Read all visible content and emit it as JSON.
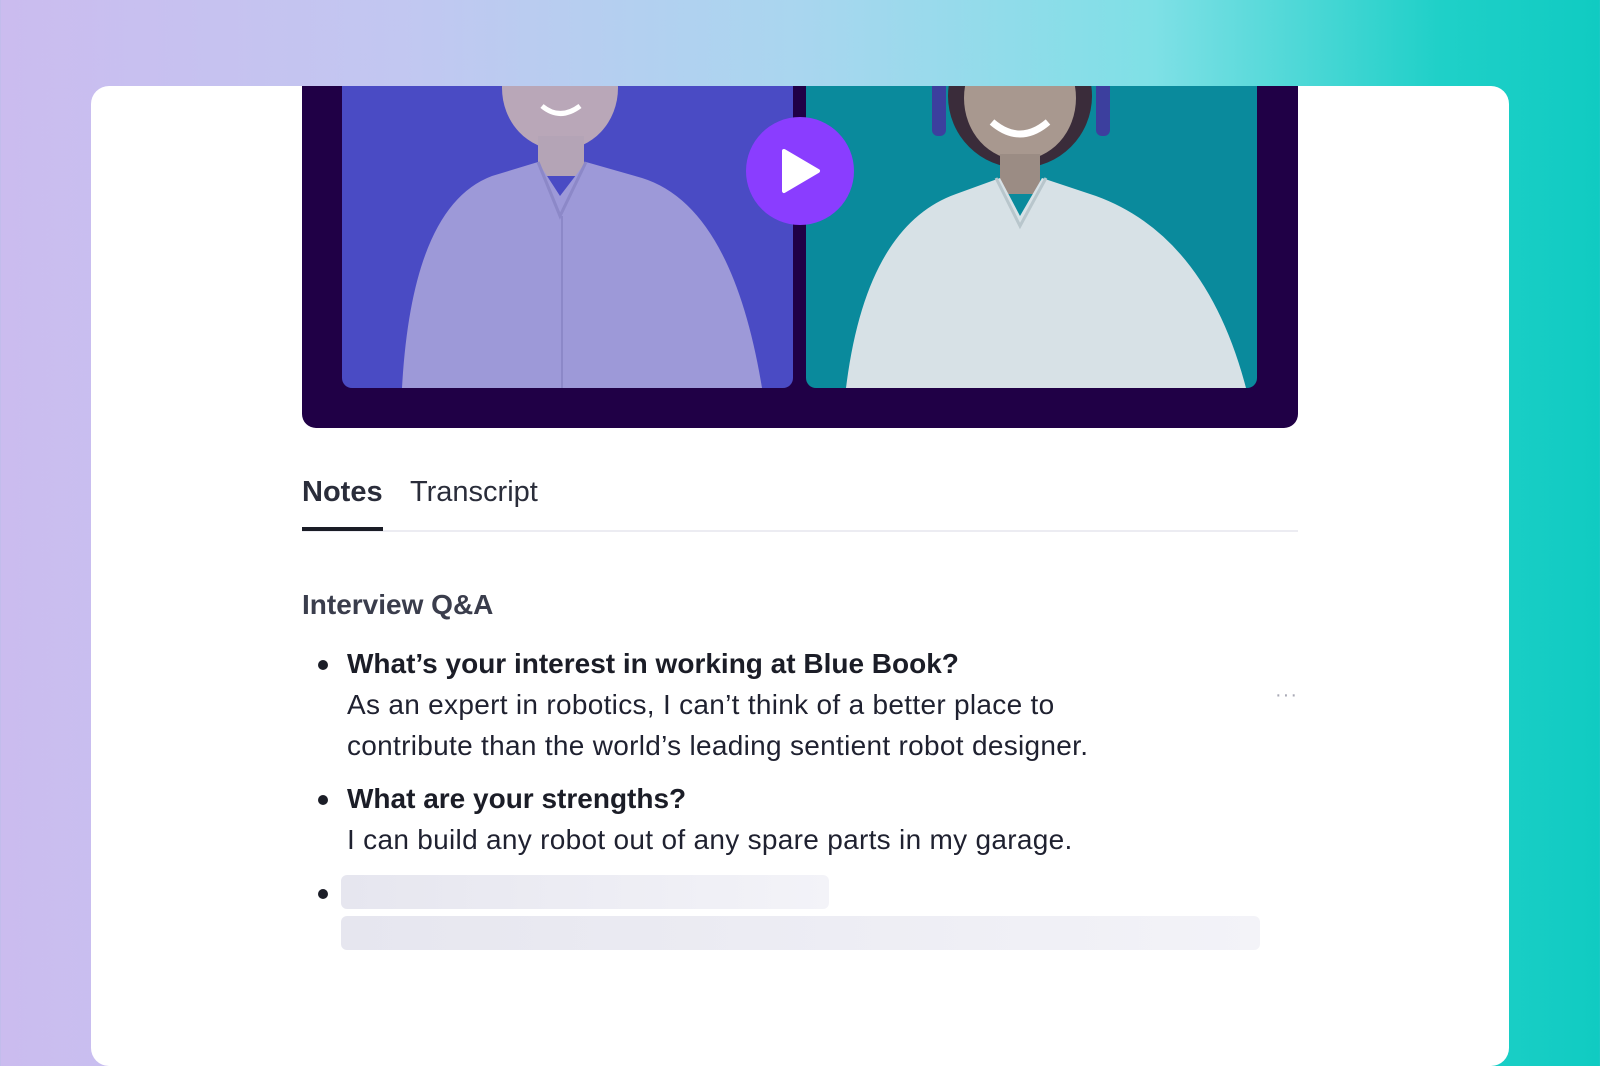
{
  "video": {
    "play_icon": "play-icon",
    "accent": "#8a3dff",
    "frame_color": "#200046"
  },
  "tabs": [
    {
      "label": "Notes",
      "active": true
    },
    {
      "label": "Transcript",
      "active": false
    }
  ],
  "notes": {
    "section_title": "Interview Q&A",
    "items": [
      {
        "question": "What’s your interest in working at Blue Book?",
        "answer_lines": [
          "As an expert in robotics, I can’t think of a better place to",
          "contribute than the world’s leading sentient robot designer."
        ]
      },
      {
        "question": "What are your strengths?",
        "answer_lines": [
          "I can build any robot out of any spare parts in my garage."
        ]
      }
    ],
    "more_icon": "ellipsis-icon",
    "more_label": "···"
  }
}
